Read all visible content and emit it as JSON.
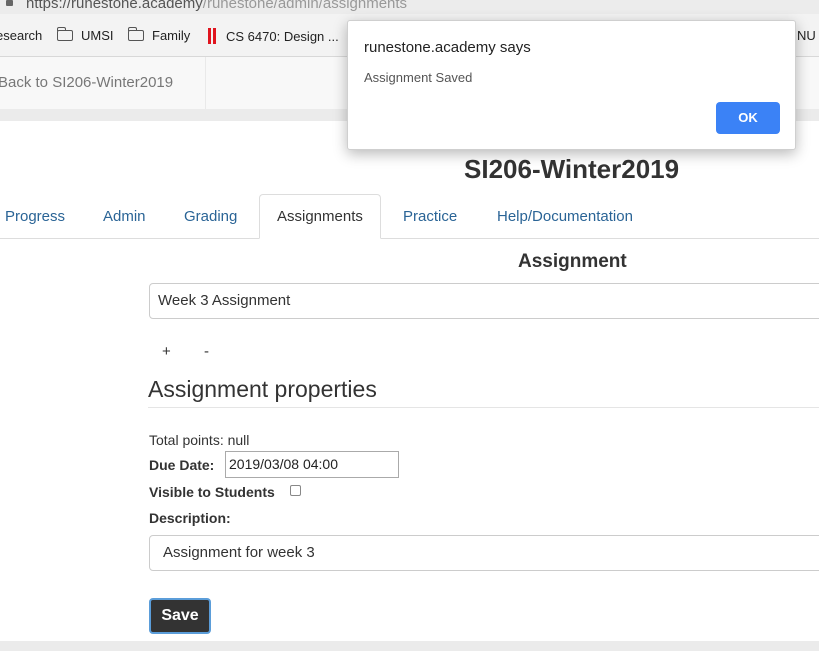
{
  "browser": {
    "url_host": "https://runestone.academy",
    "url_path": "/runestone/admin/assignments",
    "bookmarks": [
      {
        "label": "esearch",
        "icon": "none"
      },
      {
        "label": "UMSI",
        "icon": "folder-icon"
      },
      {
        "label": "Family",
        "icon": "folder-icon"
      },
      {
        "label": "CS 6470: Design ...",
        "icon": "red-bars-icon"
      },
      {
        "label": "NU",
        "icon": "none"
      }
    ]
  },
  "site": {
    "back_link": "Back to SI206-Winter2019",
    "course_title": "SI206-Winter2019"
  },
  "tabs": [
    {
      "label": "Progress",
      "active": false
    },
    {
      "label": "Admin",
      "active": false
    },
    {
      "label": "Grading",
      "active": false
    },
    {
      "label": "Assignments",
      "active": true
    },
    {
      "label": "Practice",
      "active": false
    },
    {
      "label": "Help/Documentation",
      "active": false
    }
  ],
  "assignment": {
    "heading": "Assignment",
    "name_value": "Week 3 Assignment",
    "add_label": "+",
    "remove_label": "-"
  },
  "properties": {
    "heading": "Assignment properties",
    "total_points": "Total points: null",
    "due_label": "Due Date:",
    "due_value": "2019/03/08 04:00",
    "visible_label": "Visible to Students",
    "visible_checked": false,
    "description_label": "Description:",
    "description_value": "Assignment for week 3",
    "save_label": "Save"
  },
  "dialog": {
    "title": "runestone.academy says",
    "message": "Assignment Saved",
    "ok_label": "OK"
  },
  "colors": {
    "link": "#2a6496",
    "ok_button": "#3b82f6",
    "save_button": "#333333",
    "save_focus_ring": "#5b9dd9"
  }
}
